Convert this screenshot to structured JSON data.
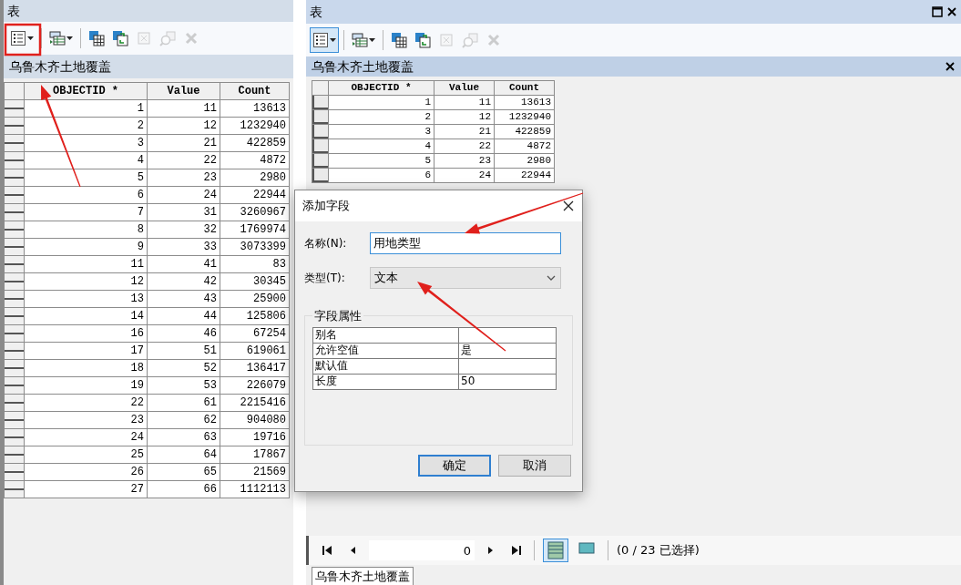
{
  "left_panel": {
    "title": "表",
    "toolbar": [
      {
        "kind": "table-options",
        "selected": false,
        "disabled": false
      },
      {
        "kind": "related-tables",
        "selected": false,
        "disabled": false
      },
      {
        "kind": "select-by-attributes",
        "selected": false,
        "disabled": false
      },
      {
        "kind": "switch-selection",
        "selected": false,
        "disabled": false
      },
      {
        "kind": "clear-selection",
        "selected": false,
        "disabled": true
      },
      {
        "kind": "zoom-to-selected",
        "selected": false,
        "disabled": true
      },
      {
        "kind": "delete-selected",
        "selected": false,
        "disabled": true
      }
    ],
    "table_title": "乌鲁木齐土地覆盖",
    "table": {
      "columns": [
        "OBJECTID *",
        "Value",
        "Count"
      ],
      "rows": [
        [
          "1",
          "11",
          "13613"
        ],
        [
          "2",
          "12",
          "1232940"
        ],
        [
          "3",
          "21",
          "422859"
        ],
        [
          "4",
          "22",
          "4872"
        ],
        [
          "5",
          "23",
          "2980"
        ],
        [
          "6",
          "24",
          "22944"
        ],
        [
          "7",
          "31",
          "3260967"
        ],
        [
          "8",
          "32",
          "1769974"
        ],
        [
          "9",
          "33",
          "3073399"
        ],
        [
          "11",
          "41",
          "83"
        ],
        [
          "12",
          "42",
          "30345"
        ],
        [
          "13",
          "43",
          "25900"
        ],
        [
          "14",
          "44",
          "125806"
        ],
        [
          "16",
          "46",
          "67254"
        ],
        [
          "17",
          "51",
          "619061"
        ],
        [
          "18",
          "52",
          "136417"
        ],
        [
          "19",
          "53",
          "226079"
        ],
        [
          "22",
          "61",
          "2215416"
        ],
        [
          "23",
          "62",
          "904080"
        ],
        [
          "24",
          "63",
          "19716"
        ],
        [
          "25",
          "64",
          "17867"
        ],
        [
          "26",
          "65",
          "21569"
        ],
        [
          "27",
          "66",
          "1112113"
        ]
      ]
    }
  },
  "right_panel": {
    "title": "表",
    "toolbar": [
      {
        "kind": "table-options",
        "selected": true,
        "disabled": false
      },
      {
        "kind": "related-tables",
        "selected": false,
        "disabled": false
      },
      {
        "kind": "select-by-attributes",
        "selected": false,
        "disabled": false
      },
      {
        "kind": "switch-selection",
        "selected": false,
        "disabled": false
      },
      {
        "kind": "clear-selection",
        "selected": false,
        "disabled": true
      },
      {
        "kind": "zoom-to-selected",
        "selected": false,
        "disabled": true
      },
      {
        "kind": "delete-selected",
        "selected": false,
        "disabled": true
      }
    ],
    "tab": "乌鲁木齐土地覆盖",
    "table": {
      "columns": [
        "OBJECTID *",
        "Value",
        "Count"
      ],
      "rows": [
        [
          "1",
          "11",
          "13613"
        ],
        [
          "2",
          "12",
          "1232940"
        ],
        [
          "3",
          "21",
          "422859"
        ],
        [
          "4",
          "22",
          "4872"
        ],
        [
          "5",
          "23",
          "2980"
        ],
        [
          "6",
          "24",
          "22944"
        ]
      ]
    },
    "navigator": {
      "record": "0",
      "views": [
        {
          "kind": "all-records",
          "selected": true
        },
        {
          "kind": "selected-records",
          "selected": false
        }
      ],
      "status": "(0 / 23 已选择)"
    },
    "bottom_tab": "乌鲁木齐土地覆盖"
  },
  "dialog": {
    "title": "添加字段",
    "name_label": "名称(N):",
    "name_value": "用地类型",
    "type_label": "类型(T):",
    "type_value": "文本",
    "group_label": "字段属性",
    "properties": [
      {
        "name": "别名"
      },
      {
        "name": "允许空值",
        "value": "是"
      },
      {
        "name": "默认值"
      },
      {
        "name": "长度",
        "value": "50"
      }
    ],
    "buttons": [
      {
        "label": "确定",
        "default": true
      },
      {
        "label": "取消",
        "default": false
      }
    ]
  }
}
